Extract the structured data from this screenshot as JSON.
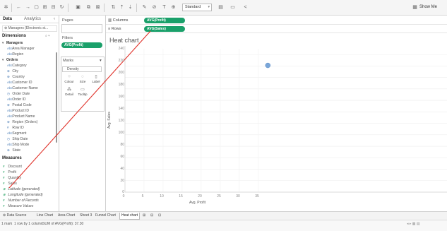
{
  "toolbar": {
    "standard_select": "Standard",
    "show_me_label": "Show Me"
  },
  "data_pane": {
    "tab_data": "Data",
    "tab_analytics": "Analytics",
    "datasource": "Managers (Electronic st...",
    "dimensions_header": "Dimensions",
    "dimension_groups": [
      {
        "label": "Managers",
        "fields": [
          "Area Manager",
          "Region"
        ]
      },
      {
        "label": "Orders",
        "fields": [
          "Category",
          "City",
          "Country",
          "Customer ID",
          "Customer Name",
          "Order Date",
          "Order ID",
          "Postal Code",
          "Product ID",
          "Product Name",
          "Region (Orders)",
          "Row ID",
          "Segment",
          "Ship Date",
          "Ship Mode",
          "State"
        ]
      }
    ],
    "measures_header": "Measures",
    "measures": [
      "Discount",
      "Profit",
      "Quantity",
      "Sales",
      "Latitude (generated)",
      "Longitude (generated)",
      "Number of Records",
      "Measure Values"
    ]
  },
  "shelves": {
    "pages_title": "Pages",
    "filters_title": "Filters",
    "filter_pill": "AVG(Profit)",
    "marks_title": "Marks",
    "marks_type": "Density",
    "marks_buttons": [
      "Colour",
      "Size",
      "Label",
      "Detail",
      "Tooltip"
    ]
  },
  "columns": {
    "label": "Columns",
    "pill": "AVG(Profit)"
  },
  "rows": {
    "label": "Rows",
    "pill": "AVG(Sales)"
  },
  "chart": {
    "title": "Heat chart",
    "y_ticks": [
      "240",
      "220",
      "200",
      "180",
      "160",
      "140",
      "120",
      "100",
      "80",
      "60",
      "40",
      "20",
      "0"
    ],
    "x_ticks": [
      "0",
      "5",
      "10",
      "15",
      "20",
      "25",
      "30",
      "35"
    ],
    "y_axis_title": "Avg. Sales",
    "x_axis_title": "Avg. Profit"
  },
  "chart_data": {
    "type": "scatter",
    "title": "Heat chart",
    "xlabel": "Avg. Profit",
    "ylabel": "Avg. Sales",
    "xlim": [
      0,
      38
    ],
    "ylim": [
      0,
      250
    ],
    "points": [
      {
        "x": 37.5,
        "y": 221
      }
    ],
    "grid": true,
    "point_color": "#7aa6d8"
  },
  "sheet_tabs": {
    "data_source": "Data Source",
    "tabs": [
      "Line Chart",
      "Area Chart",
      "Sheet 3",
      "Funnel Chart",
      "Heat chart"
    ],
    "active": "Heat chart"
  },
  "status": {
    "marks": "1 mark",
    "rowcol": "1 row by 1 column",
    "sum": "SUM of AVG(Profit): 37.30"
  },
  "colors": {
    "pill_green": "#1aa06a",
    "annotation_red": "#e0322a"
  }
}
